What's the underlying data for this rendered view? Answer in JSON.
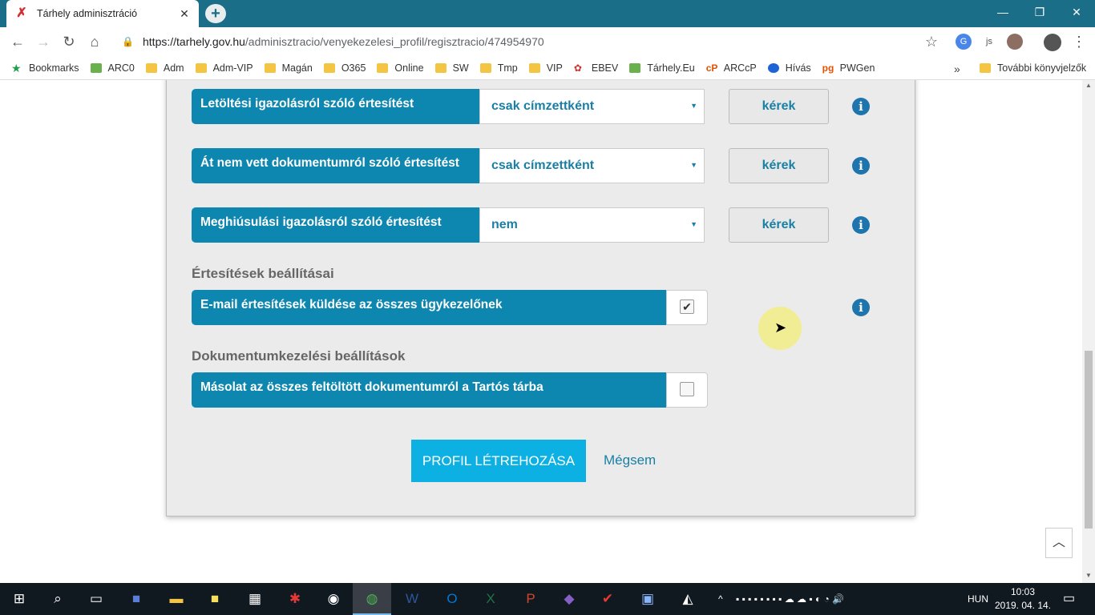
{
  "browser": {
    "tab_title": "Tárhely adminisztráció",
    "url_host": "https://tarhely.gov.hu",
    "url_path": "/adminisztracio/venyekezelesi_profil/regisztracio/474954970",
    "bookmarks": [
      "Bookmarks",
      "ARC0",
      "Adm",
      "Adm-VIP",
      "Magán",
      "O365",
      "Online",
      "SW",
      "Tmp",
      "VIP",
      "EBEV",
      "Tárhely.Eu",
      "ARCcP",
      "Hívás",
      "PWGen"
    ],
    "more_bookmarks": "»",
    "other_bookmarks": "További könyvjelzők"
  },
  "form": {
    "rows": [
      {
        "label": "Letöltési igazolásról szóló értesítést",
        "select": "csak címzettként",
        "button": "kérek"
      },
      {
        "label": "Át nem vett dokumentumról szóló értesítést",
        "select": "csak címzettként",
        "button": "kérek"
      },
      {
        "label": "Meghiúsulási igazolásról szóló értesítést",
        "select": "nem",
        "button": "kérek"
      }
    ],
    "notif_section_title": "Értesítések beállításai",
    "email_label": "E-mail értesítések küldése az összes ügykezelőnek",
    "email_checked": true,
    "doc_section_title": "Dokumentumkezelési beállítások",
    "copy_label": "Másolat az összes feltöltött dokumentumról a Tartós tárba",
    "copy_checked": false,
    "submit_label": "PROFIL LÉTREHOZÁSA",
    "cancel_label": "Mégsem",
    "info_symbol": "i"
  },
  "taskbar": {
    "language": "HUN",
    "time": "10:03",
    "date": "2019. 04. 14."
  },
  "colors": {
    "title_bar": "#1b6e87",
    "label_bg": "#0e87b0",
    "primary_button": "#0cb0e2",
    "info_icon": "#1e74ad"
  }
}
